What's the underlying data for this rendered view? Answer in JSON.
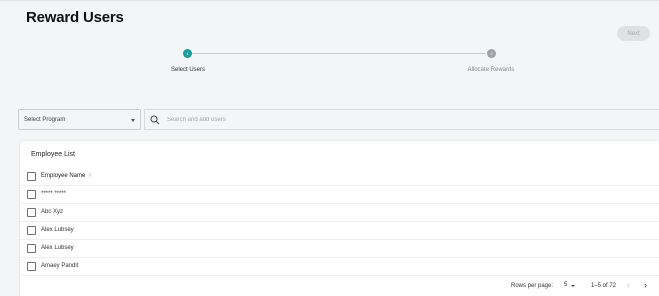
{
  "page": {
    "title": "Reward Users"
  },
  "header": {
    "next_label": "Next"
  },
  "stepper": {
    "steps": [
      {
        "number": "1",
        "label": "Select Users",
        "state": "active",
        "color": "#1c9a9a"
      },
      {
        "number": "2",
        "label": "Allocate Rewards",
        "state": "inactive",
        "color": "#9ea2a8"
      }
    ]
  },
  "filters": {
    "program_placeholder": "Select Program",
    "search_placeholder": "Search and add users",
    "search_value": ""
  },
  "employee_list": {
    "title": "Employee List",
    "column_header": "Employee Name",
    "sort_indicator": "↑",
    "rows": [
      {
        "name": "***** *****"
      },
      {
        "name": "Abc Xyz"
      },
      {
        "name": "Alex Lubsey"
      },
      {
        "name": "Alex Lubsey"
      },
      {
        "name": "Amaey Pandit"
      }
    ]
  },
  "pagination": {
    "rows_per_page_label": "Rows per page:",
    "rows_per_page_value": "5",
    "range_label": "1–5 of 72",
    "prev_icon": "‹",
    "next_icon": "›"
  }
}
